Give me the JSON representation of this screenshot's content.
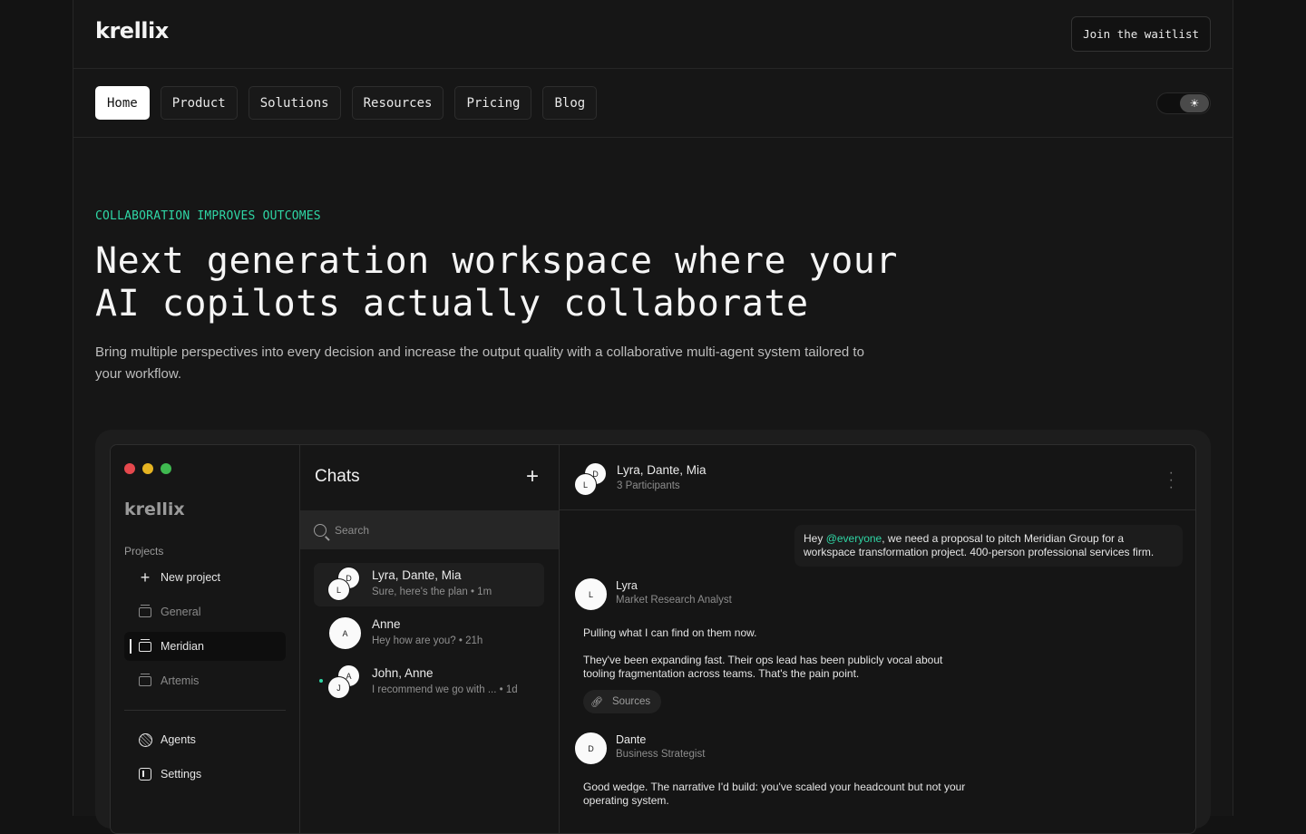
{
  "header": {
    "logo": "krellix",
    "cta_label": "Join the waitlist"
  },
  "nav": {
    "items": [
      {
        "label": "Home",
        "active": true
      },
      {
        "label": "Product"
      },
      {
        "label": "Solutions"
      },
      {
        "label": "Resources"
      },
      {
        "label": "Pricing"
      },
      {
        "label": "Blog"
      }
    ],
    "theme_toggle_icon": "sun-icon"
  },
  "hero": {
    "eyebrow": "COLLABORATION IMPROVES OUTCOMES",
    "headline_line1": "Next generation workspace where your",
    "headline_line2": "AI copilots actually collaborate",
    "subhead": "Bring multiple perspectives into every decision and increase the output quality with a collaborative multi-agent system tailored to your workflow."
  },
  "colors": {
    "accent": "#2fd6a5",
    "window_close": "#e5484d",
    "window_minimize": "#e6b422",
    "window_maximize": "#3fb950"
  },
  "app": {
    "logo": "krellix",
    "sidebar": {
      "projects_heading": "Projects",
      "new_project": "New project",
      "projects": [
        "General",
        "Meridian",
        "Artemis"
      ],
      "selected_project": "Meridian",
      "agents": "Agents",
      "settings": "Settings"
    },
    "chats": {
      "title": "Chats",
      "search_placeholder": "Search",
      "items": [
        {
          "name": "Lyra, Dante, Mia",
          "preview": "Sure, here's the plan • 1m",
          "avatars": [
            "D",
            "L"
          ]
        },
        {
          "name": "Anne",
          "preview": "Hey how are you? • 21h",
          "avatars": [
            "A"
          ]
        },
        {
          "name": "John, Anne",
          "preview": "I recommend we go with ... • 1d",
          "avatars": [
            "A",
            "J"
          ]
        }
      ]
    },
    "conversation": {
      "title": "Lyra, Dante, Mia",
      "participants": "3 Participants",
      "avatars": [
        "D",
        "L"
      ],
      "user_message": {
        "prefix": "Hey ",
        "mention": "@everyone",
        "text": ", we need a proposal to pitch Meridian Group for a workspace transformation project. 400-person professional services firm."
      },
      "messages": [
        {
          "sender": "Lyra",
          "role": "Market Research Analyst",
          "avatar": "L",
          "paragraphs": [
            "Pulling what I can find on them now.",
            "They've been expanding fast. Their ops lead has been publicly vocal about tooling fragmentation across teams. That's the pain point."
          ],
          "sources_label": "Sources"
        },
        {
          "sender": "Dante",
          "role": "Business Strategist",
          "avatar": "D",
          "paragraphs": [
            "Good wedge. The narrative I'd build: you've scaled your headcount but not your operating system."
          ]
        }
      ]
    }
  }
}
